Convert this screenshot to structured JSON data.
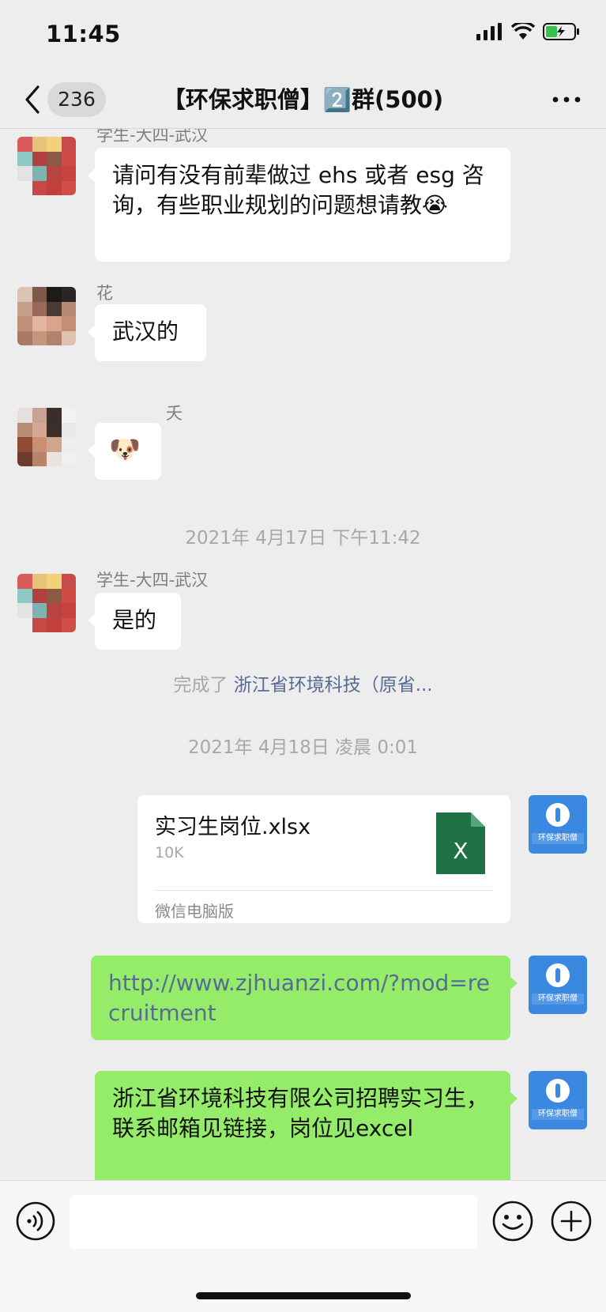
{
  "status_bar": {
    "time": "11:45"
  },
  "nav": {
    "unread_count": "236",
    "title": "【环保求职僧】2️⃣群(500)"
  },
  "messages": {
    "m1": {
      "sender": "学生-大四-武汉",
      "text": " 请问有没有前辈做过 ehs 或者 esg 咨询，有些职业规划的问题想请教😭"
    },
    "m2": {
      "sender": "花",
      "text": "武汉的"
    },
    "m3": {
      "sender": "夭",
      "text": "🐶"
    },
    "ts1": "2021年 4月17日 下午11:42",
    "m4": {
      "sender": "学生-大四-武汉",
      "text": "是的"
    },
    "sys1": {
      "prefix": "完成了 ",
      "link": "浙江省环境科技（原省..."
    },
    "ts2": "2021年 4月18日 凌晨 0:01",
    "file": {
      "name": "实习生岗位.xlsx",
      "size": "10K",
      "source": "微信电脑版",
      "icon": "excel-icon",
      "icon_letter": "X"
    },
    "m5": {
      "text": "http://www.zjhuanzi.com/?mod=recruitment"
    },
    "m6": {
      "text": "浙江省环境科技有限公司招聘实习生，联系邮箱见链接，岗位见excel"
    }
  },
  "brand_avatar_text": "环保求职僧",
  "input": {
    "placeholder": ""
  },
  "colors": {
    "background": "#ededed",
    "sent_bubble": "#95ec69",
    "link": "#576b95",
    "brand": "#3a88e0",
    "excel": "#1f7244"
  }
}
